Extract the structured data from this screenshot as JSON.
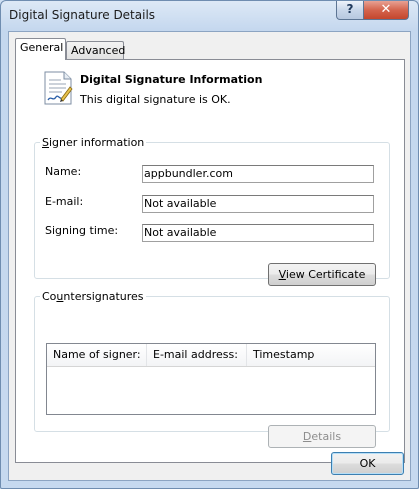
{
  "window": {
    "title": "Digital Signature Details",
    "help_label": "?",
    "close_label": "✕"
  },
  "tabs": [
    {
      "label": "General",
      "selected": true
    },
    {
      "label": "Advanced",
      "selected": false
    }
  ],
  "header": {
    "title": "Digital Signature Information",
    "status": "This digital signature is OK."
  },
  "signer": {
    "legend_prefix": "S",
    "legend_rest": "igner information",
    "name_label": "Name:",
    "name_value": "appbundler.com",
    "email_label": "E-mail:",
    "email_value": "Not available",
    "time_label": "Signing time:",
    "time_value": "Not available",
    "view_prefix": "V",
    "view_rest": "iew Certificate"
  },
  "countersignatures": {
    "legend_pre": "Co",
    "legend_u": "u",
    "legend_post": "ntersignatures",
    "columns": [
      "Name of signer:",
      "E-mail address:",
      "Timestamp"
    ],
    "details_prefix": "D",
    "details_rest": "etails"
  },
  "footer": {
    "ok_label": "OK"
  }
}
